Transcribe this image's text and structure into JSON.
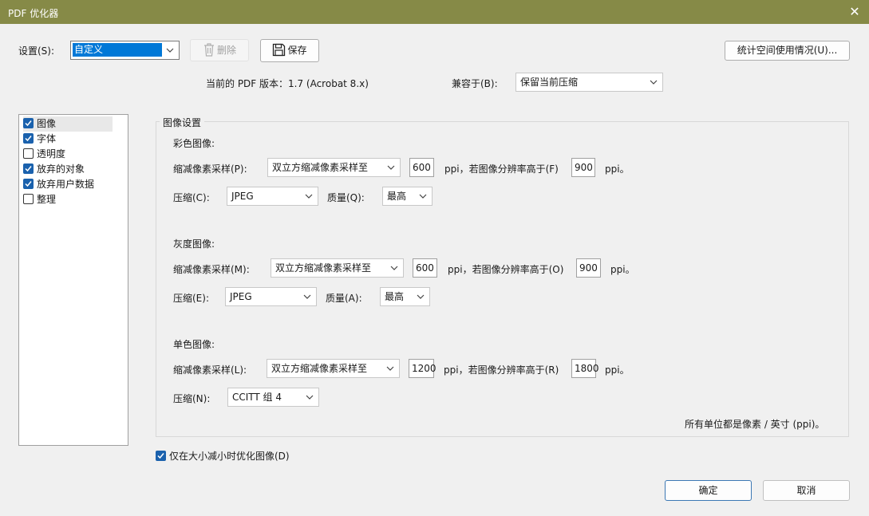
{
  "window": {
    "title": "PDF 优化器",
    "close_glyph": "✕"
  },
  "settings": {
    "label": "设置(S):",
    "value": "自定义",
    "delete_label": "删除",
    "save_label": "保存",
    "audit_label": "统计空间使用情况(U)..."
  },
  "version": {
    "text": "当前的 PDF 版本：1.7 (Acrobat 8.x)",
    "compat_label": "兼容于(B):",
    "compat_value": "保留当前压缩"
  },
  "sidebar": {
    "items": [
      {
        "label": "图像",
        "checked": true
      },
      {
        "label": "字体",
        "checked": true
      },
      {
        "label": "透明度",
        "checked": false
      },
      {
        "label": "放弃的对象",
        "checked": true
      },
      {
        "label": "放弃用户数据",
        "checked": true
      },
      {
        "label": "整理",
        "checked": false
      }
    ]
  },
  "image_settings": {
    "title": "图像设置",
    "color": {
      "heading": "彩色图像:",
      "downsample_label": "缩减像素采样(P):",
      "downsample_value": "双立方缩减像素采样至",
      "ppi_value": "600",
      "ppi_mid_text": "ppi，若图像分辨率高于(F)",
      "above_value": "900",
      "ppi_end": "ppi。",
      "compression_label": "压缩(C):",
      "compression_value": "JPEG",
      "quality_label": "质量(Q):",
      "quality_value": "最高"
    },
    "gray": {
      "heading": "灰度图像:",
      "downsample_label": "缩减像素采样(M):",
      "downsample_value": "双立方缩减像素采样至",
      "ppi_value": "600",
      "ppi_mid_text": "ppi，若图像分辨率高于(O)",
      "above_value": "900",
      "ppi_end": "ppi。",
      "compression_label": "压缩(E):",
      "compression_value": "JPEG",
      "quality_label": "质量(A):",
      "quality_value": "最高"
    },
    "mono": {
      "heading": "单色图像:",
      "downsample_label": "缩减像素采样(L):",
      "downsample_value": "双立方缩减像素采样至",
      "ppi_value": "1200",
      "ppi_mid_text": "ppi，若图像分辨率高于(R)",
      "above_value": "1800",
      "ppi_end": "ppi。",
      "compression_label": "压缩(N):",
      "compression_value": "CCITT 组 4"
    },
    "units_note": "所有单位都是像素 / 英寸 (ppi)。"
  },
  "optimize_only_smaller": {
    "label": "仅在大小减小时优化图像(D)",
    "checked": true
  },
  "footer": {
    "ok_label": "确定",
    "cancel_label": "取消"
  },
  "colors": {
    "titlebar": "#868a47",
    "accent": "#0078d7",
    "checkbox": "#1a61ad"
  }
}
